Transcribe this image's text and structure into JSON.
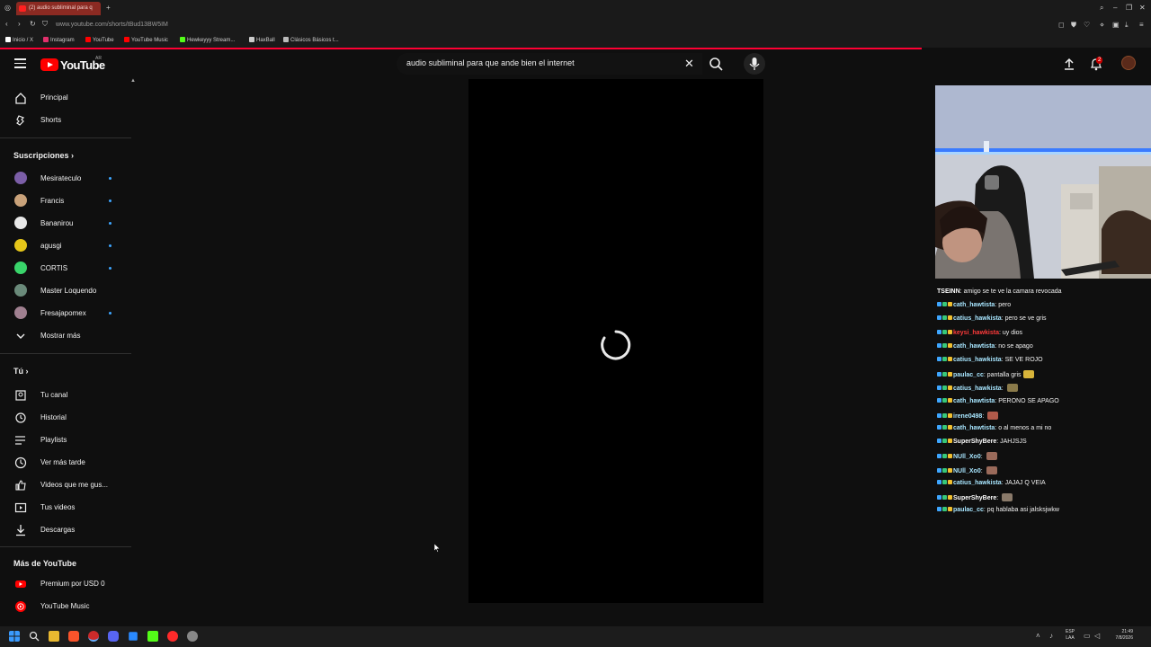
{
  "browser": {
    "tab_title": "(2) audio subliminal para q",
    "url": "www.youtube.com/shorts/tBud13BW5IM",
    "bookmarks": [
      {
        "label": "Inicio / X",
        "color": "#ffffff"
      },
      {
        "label": "Instagram",
        "color": "#e1306c"
      },
      {
        "label": "YouTube",
        "color": "#ff0000"
      },
      {
        "label": "YouTube Music",
        "color": "#ff0000"
      },
      {
        "label": "Hewkeyyy Stream...",
        "color": "#53fc18"
      },
      {
        "label": "HaxBall",
        "color": "#cccccc"
      },
      {
        "label": "Clásicos Básicos t...",
        "color": "#bbbbbb"
      }
    ]
  },
  "header": {
    "logo": "YouTube",
    "country": "AR",
    "search_query": "audio subliminal para que ande bien el internet",
    "notification_count": "2"
  },
  "sidebar": {
    "main": [
      {
        "label": "Principal",
        "icon": "home-icon"
      },
      {
        "label": "Shorts",
        "icon": "shorts-icon"
      }
    ],
    "subscriptions_title": "Suscripciones",
    "subscriptions": [
      {
        "label": "Mesirateculo",
        "color": "#7b5ea7"
      },
      {
        "label": "Francis",
        "color": "#c9a27a"
      },
      {
        "label": "Bananirou",
        "color": "#e8e8e8"
      },
      {
        "label": "agusgi",
        "color": "#e6c619"
      },
      {
        "label": "CORTIS",
        "color": "#39d46a"
      },
      {
        "label": "Master Loquendo",
        "color": "#6a8a7a"
      },
      {
        "label": "Fresajapomex",
        "color": "#a08090"
      }
    ],
    "show_more": "Mostrar más",
    "you_title": "Tú",
    "you": [
      {
        "label": "Tu canal",
        "icon": "channel-icon"
      },
      {
        "label": "Historial",
        "icon": "history-icon"
      },
      {
        "label": "Playlists",
        "icon": "playlists-icon"
      },
      {
        "label": "Ver más tarde",
        "icon": "watch-later-icon"
      },
      {
        "label": "Videos que me gus...",
        "icon": "like-icon"
      },
      {
        "label": "Tus videos",
        "icon": "your-videos-icon"
      },
      {
        "label": "Descargas",
        "icon": "download-icon"
      }
    ],
    "more_title": "Más de YouTube",
    "more": [
      {
        "label": "Premium por USD 0",
        "icon": "premium-icon"
      },
      {
        "label": "YouTube Music",
        "icon": "youtube-music-icon"
      }
    ]
  },
  "chat": {
    "messages": [
      {
        "user": "TSEINN",
        "user_color": "#ffffff",
        "text": "amigo se te ve la camara revocada",
        "emote": ""
      },
      {
        "user": "cath_hawtista",
        "user_color": "#a8e6ff",
        "text": "pero",
        "emote": ""
      },
      {
        "user": "catius_hawkista",
        "user_color": "#a8e6ff",
        "text": "pero se ve gris",
        "emote": ""
      },
      {
        "user": "keysi_hawkista",
        "user_color": "#ff3b3b",
        "text": "uy dios",
        "emote": ""
      },
      {
        "user": "cath_hawtista",
        "user_color": "#a8e6ff",
        "text": "no se apago",
        "emote": ""
      },
      {
        "user": "catius_hawkista",
        "user_color": "#a8e6ff",
        "text": "SE VE ROJO",
        "emote": ""
      },
      {
        "user": "paulac_cc",
        "user_color": "#a8e6ff",
        "text": "pantalla gris",
        "emote": "#d8b43a"
      },
      {
        "user": "catius_hawkista",
        "user_color": "#a8e6ff",
        "text": "",
        "emote": "#8a7a4a"
      },
      {
        "user": "cath_hawtista",
        "user_color": "#a8e6ff",
        "text": "PERONO SE APAGO",
        "emote": ""
      },
      {
        "user": "irene0498",
        "user_color": "#a8e6ff",
        "text": "",
        "emote": "#b05a4a"
      },
      {
        "user": "cath_hawtista",
        "user_color": "#a8e6ff",
        "text": "o al menos a mi no",
        "emote": ""
      },
      {
        "user": "SuperShyBere",
        "user_color": "#ffffff",
        "text": "JAHJSJS",
        "emote": ""
      },
      {
        "user": "NUll_Xo0",
        "user_color": "#a8e6ff",
        "text": "",
        "emote": "#9a6a5a"
      },
      {
        "user": "NUll_Xo0",
        "user_color": "#a8e6ff",
        "text": "",
        "emote": "#9a6a5a"
      },
      {
        "user": "catius_hawkista",
        "user_color": "#a8e6ff",
        "text": "JAJAJ Q VEIA",
        "emote": ""
      },
      {
        "user": "SuperShyBere",
        "user_color": "#ffffff",
        "text": "",
        "emote": "#8a7a6a"
      },
      {
        "user": "paulac_cc",
        "user_color": "#a8e6ff",
        "text": "pq hablaba asi jalsksjwkw",
        "emote": ""
      }
    ]
  },
  "taskbar": {
    "lang_1": "ESP",
    "lang_2": "LAA",
    "time": "21:49",
    "date": "7/8/2026"
  },
  "colors": {
    "background": "#0f0f0f",
    "accent": "#ff0000",
    "subscription_dot": "#3ea6ff"
  }
}
